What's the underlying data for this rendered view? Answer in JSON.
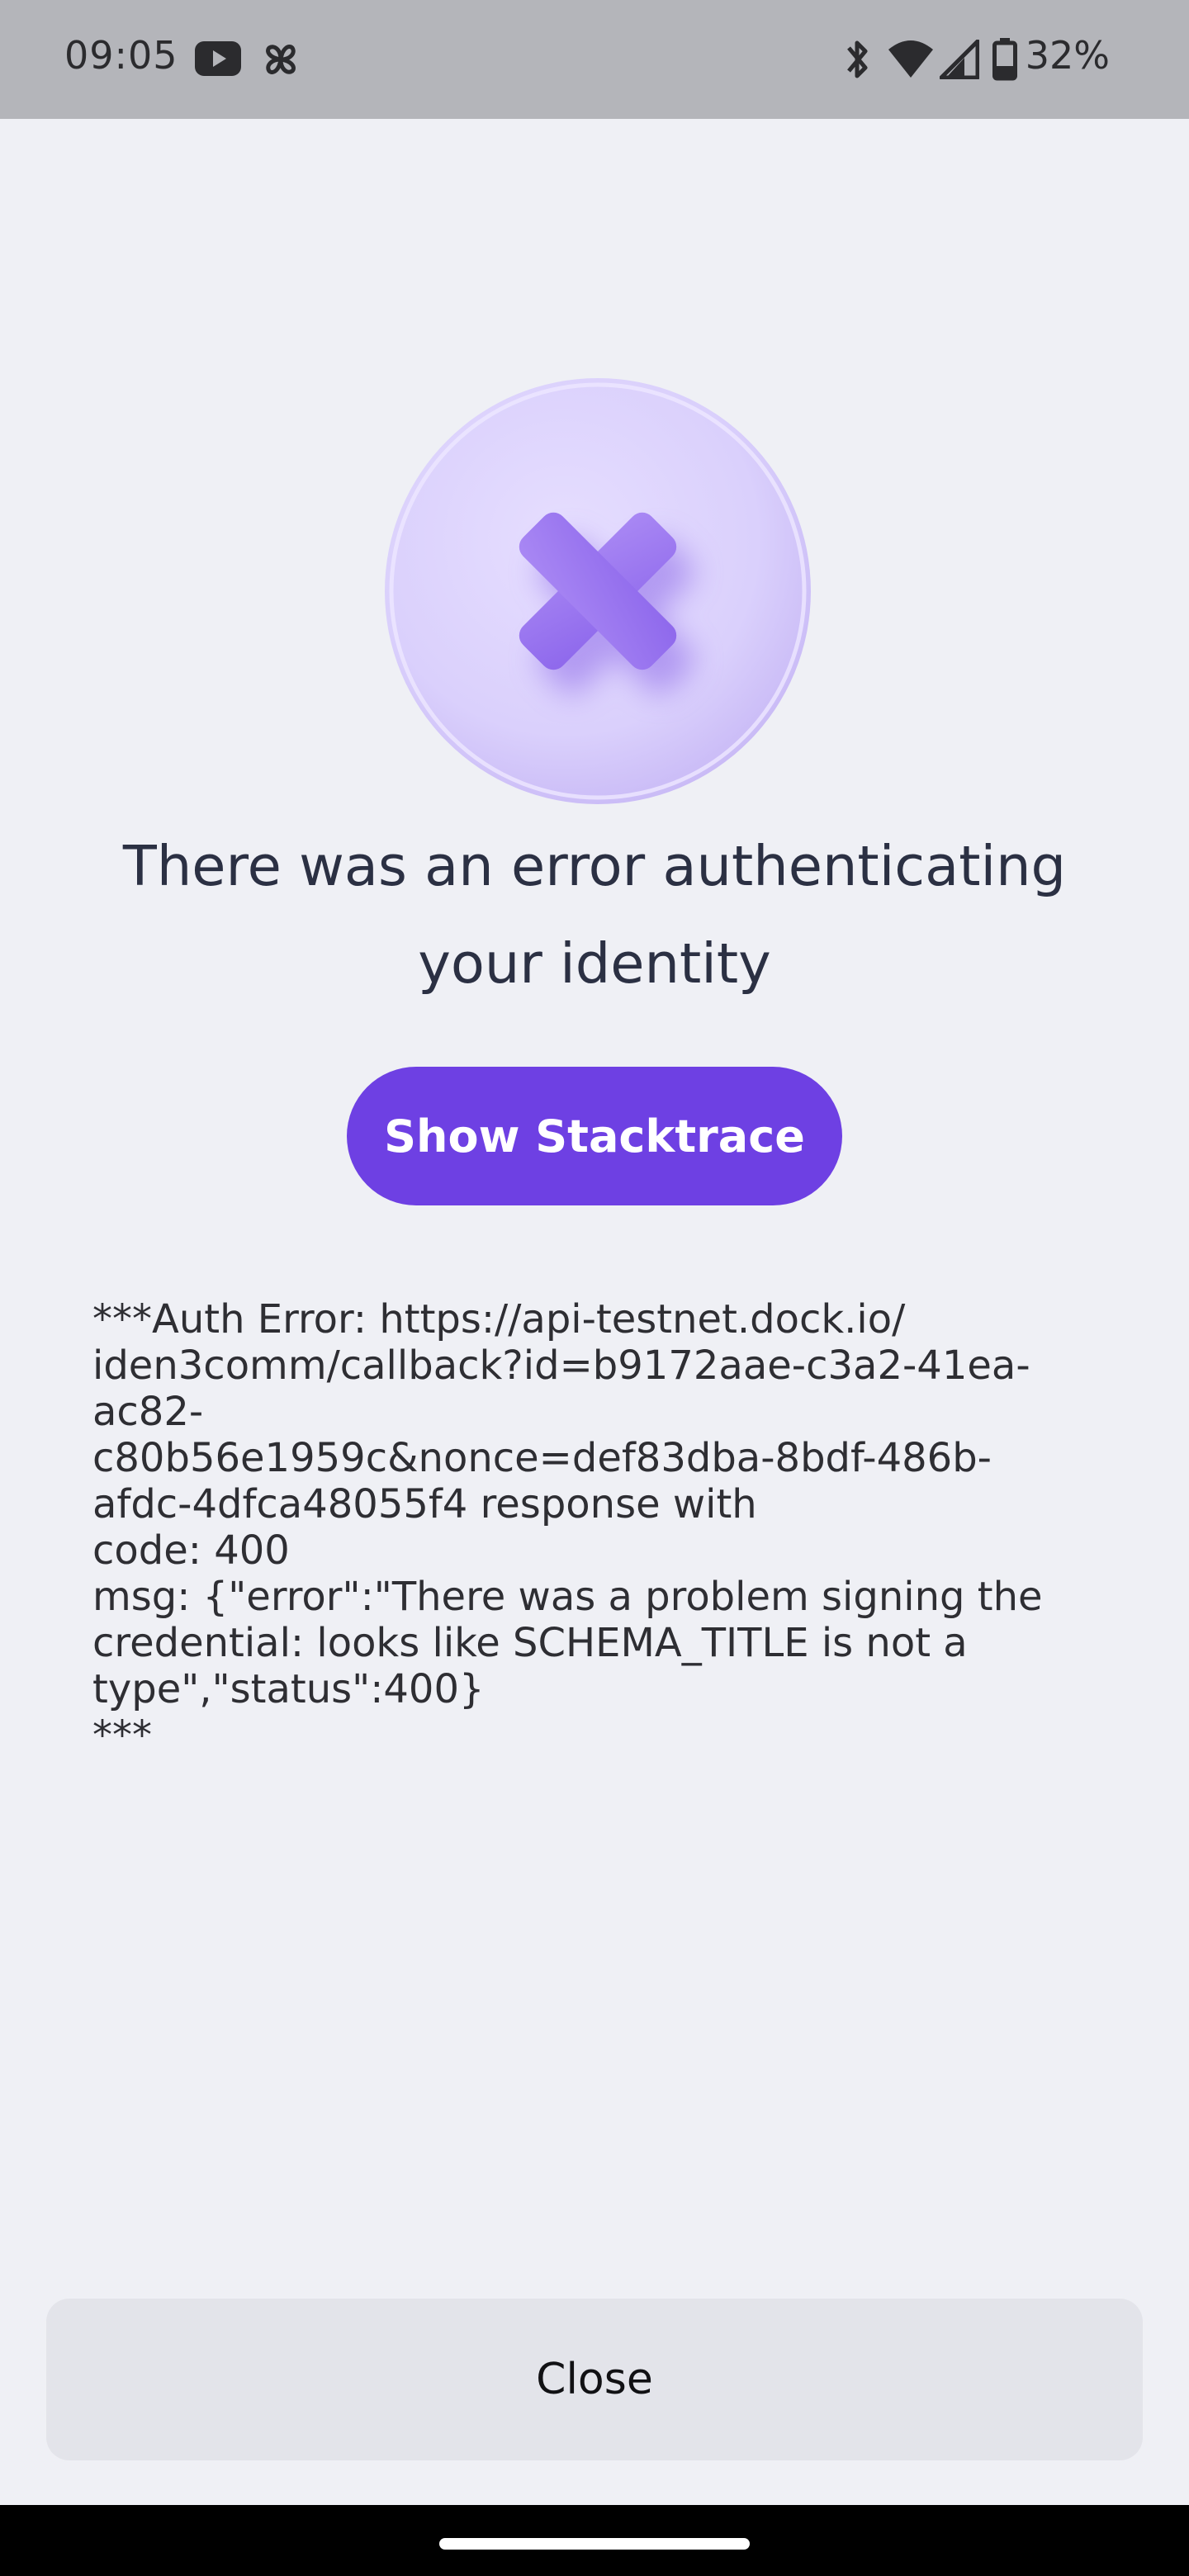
{
  "status_bar": {
    "time": "09:05",
    "battery_percent": "32%",
    "icons": [
      "youtube-icon",
      "pinwheel-icon",
      "bluetooth-icon",
      "wifi-icon",
      "cell-signal-icon",
      "battery-icon"
    ]
  },
  "error": {
    "icon": "close-x-icon",
    "accent_color": "#6E40E3",
    "heading_line1": "There was an error authenticating",
    "heading_line2": "your identity"
  },
  "actions": {
    "show_stacktrace_label": "Show Stacktrace",
    "close_label": "Close"
  },
  "stacktrace": {
    "text": "***Auth Error: https://api-testnet.dock.io/\niden3comm/callback?id=b9172aae-c3a2-41ea-\nac82-\nc80b56e1959c&nonce=def83dba-8bdf-486b-\nafdc-4dfca48055f4 response with\ncode: 400\nmsg: {\"error\":\"There was a problem signing the\ncredential: looks like SCHEMA_TITLE is not a\ntype\",\"status\":400}\n***"
  }
}
